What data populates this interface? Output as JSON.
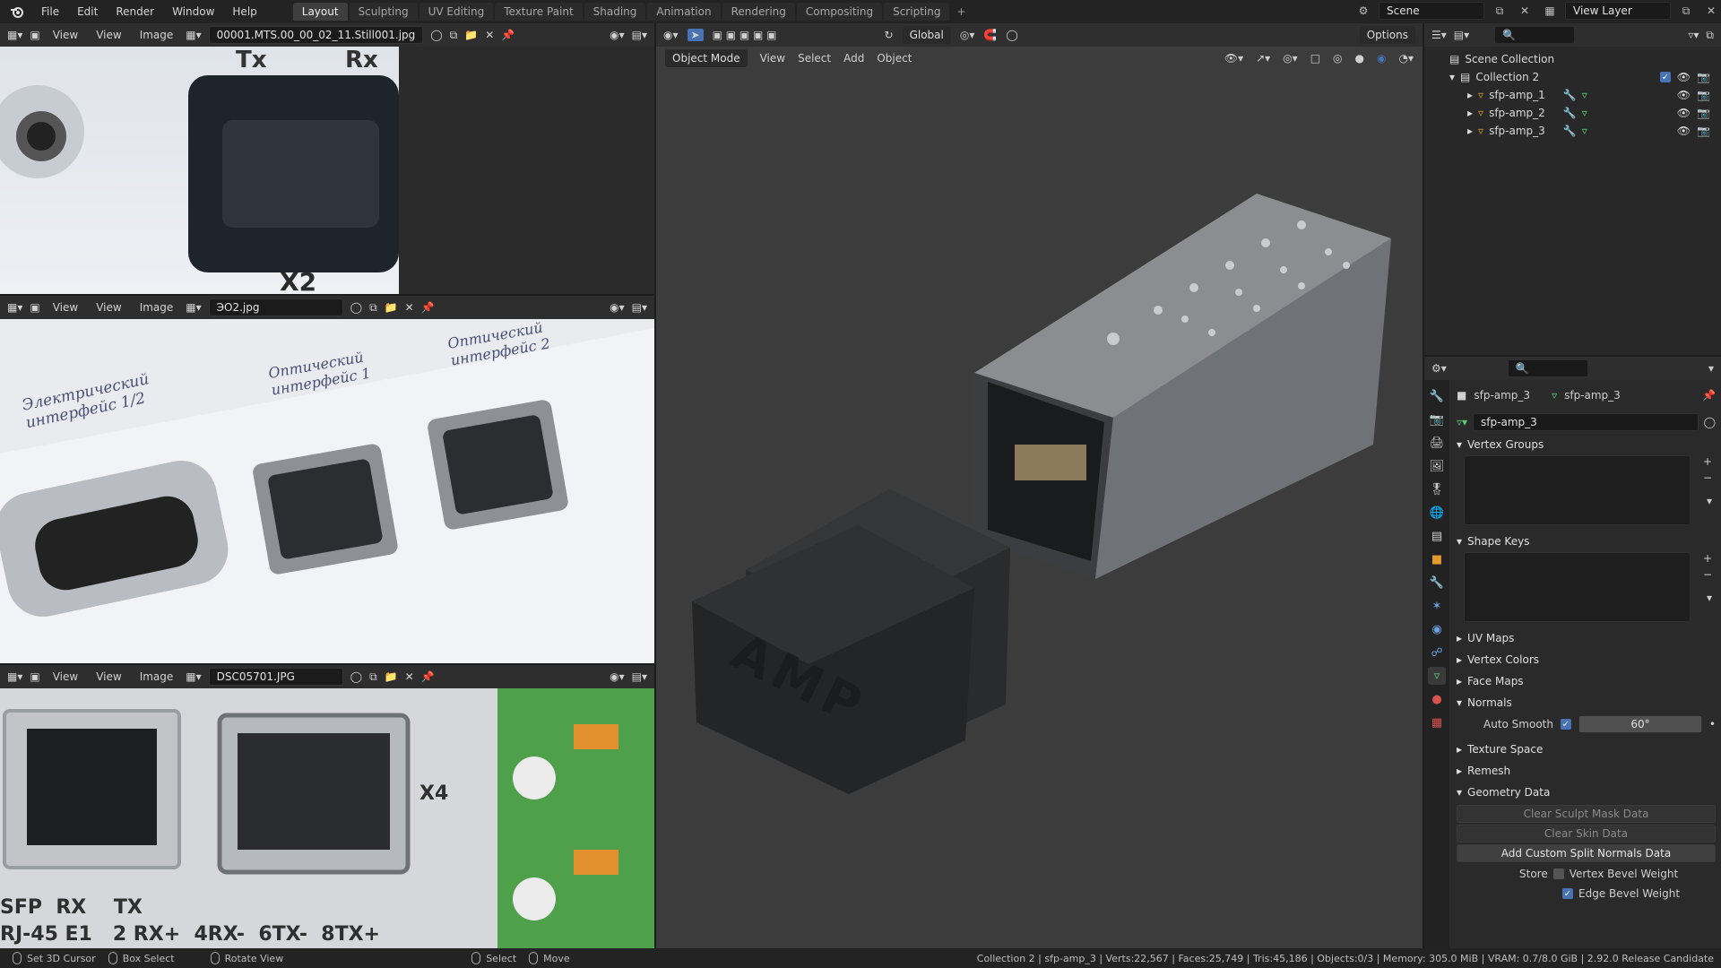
{
  "menu": [
    "File",
    "Edit",
    "Render",
    "Window",
    "Help"
  ],
  "workspaces": [
    "Layout",
    "Sculpting",
    "UV Editing",
    "Texture Paint",
    "Shading",
    "Animation",
    "Rendering",
    "Compositing",
    "Scripting"
  ],
  "workspace_add": "+",
  "scene_name": "Scene",
  "view_layer": "View Layer",
  "image_editors": [
    {
      "view": "View",
      "view2": "View",
      "image": "Image",
      "filename": "00001.MTS.00_00_02_11.Still001.jpg"
    },
    {
      "view": "View",
      "view2": "View",
      "image": "Image",
      "filename": "ЭО2.jpg"
    },
    {
      "view": "View",
      "view2": "View",
      "image": "Image",
      "filename": "DSC05701.JPG"
    }
  ],
  "photo1": {
    "label_tx": "Tx",
    "label_rx": "Rx",
    "label_x2": "X2"
  },
  "photo2": {
    "label_a": "Электрический интерфейс 1/2",
    "label_b": "Оптический интерфейс 1",
    "label_c": "Оптический интерфейс 2"
  },
  "photo3": {
    "x4": "X4",
    "row1": "SFP  RX    TX",
    "row2": "RJ-45 E1   2 RX+  4RX-  6TX-  8TX+"
  },
  "viewport": {
    "mode": "Object Mode",
    "menus": [
      "View",
      "Select",
      "Add",
      "Object"
    ],
    "orientation": "Global",
    "options": "Options",
    "cap_text": "AMP"
  },
  "outliner": {
    "scene_collection": "Scene Collection",
    "collection": "Collection 2",
    "objects": [
      "sfp-amp_1",
      "sfp-amp_2",
      "sfp-amp_3"
    ]
  },
  "properties": {
    "breadcrumb_object": "sfp-amp_3",
    "breadcrumb_mesh": "sfp-amp_3",
    "mesh_name": "sfp-amp_3",
    "panels": {
      "vertex_groups": "Vertex Groups",
      "shape_keys": "Shape Keys",
      "uv_maps": "UV Maps",
      "vertex_colors": "Vertex Colors",
      "face_maps": "Face Maps",
      "normals": "Normals",
      "texture_space": "Texture Space",
      "remesh": "Remesh",
      "geometry_data": "Geometry Data"
    },
    "auto_smooth_label": "Auto Smooth",
    "auto_smooth_angle": "60°",
    "clear_sculpt": "Clear Sculpt Mask Data",
    "clear_skin": "Clear Skin Data",
    "add_split_normals": "Add Custom Split Normals Data",
    "store_label": "Store",
    "vertex_bevel": "Vertex Bevel Weight",
    "edge_bevel": "Edge Bevel Weight"
  },
  "status": {
    "set_cursor": "Set 3D Cursor",
    "box_select": "Box Select",
    "rotate_view": "Rotate View",
    "select": "Select",
    "move": "Move",
    "info": "Collection 2 | sfp-amp_3 | Verts:22,567 | Faces:25,749 | Tris:45,186 | Objects:0/3 | Memory: 305.0 MiB | VRAM: 0.7/8.0 GiB | 2.92.0 Release Candidate"
  },
  "colors": {
    "accent": "#4772b3",
    "header": "#2e2e2e",
    "viewport_bg": "#3c3c3c",
    "object_orange": "#e39a2c"
  }
}
